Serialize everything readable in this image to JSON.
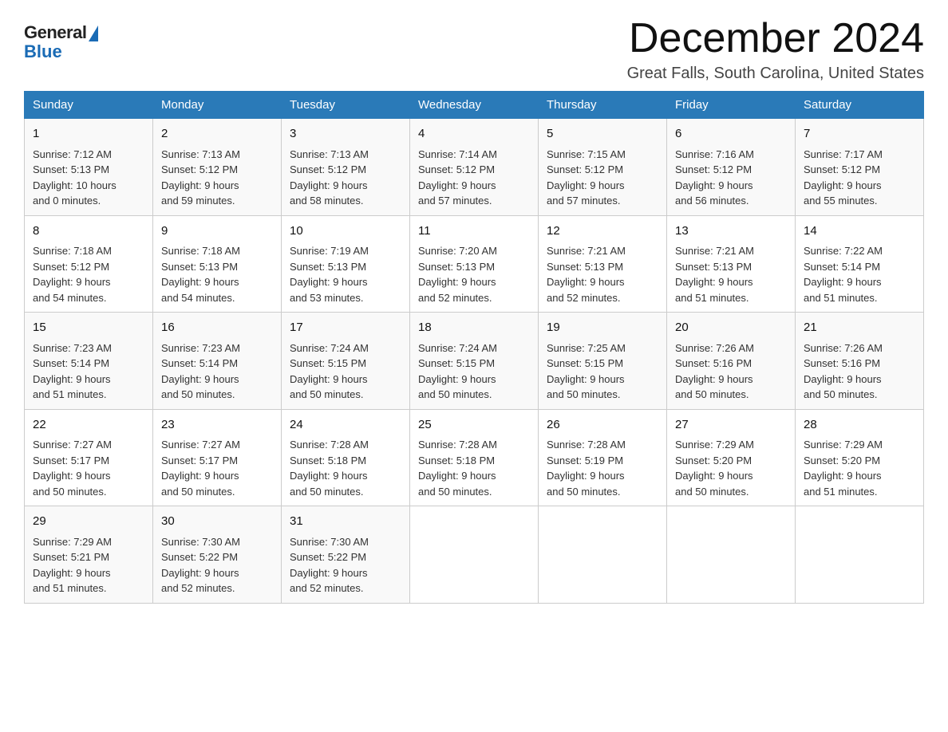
{
  "logo": {
    "general": "General",
    "blue": "Blue"
  },
  "header": {
    "month_year": "December 2024",
    "location": "Great Falls, South Carolina, United States"
  },
  "days_of_week": [
    "Sunday",
    "Monday",
    "Tuesday",
    "Wednesday",
    "Thursday",
    "Friday",
    "Saturday"
  ],
  "weeks": [
    [
      {
        "day": "1",
        "sunrise": "7:12 AM",
        "sunset": "5:13 PM",
        "daylight": "10 hours and 0 minutes."
      },
      {
        "day": "2",
        "sunrise": "7:13 AM",
        "sunset": "5:12 PM",
        "daylight": "9 hours and 59 minutes."
      },
      {
        "day": "3",
        "sunrise": "7:13 AM",
        "sunset": "5:12 PM",
        "daylight": "9 hours and 58 minutes."
      },
      {
        "day": "4",
        "sunrise": "7:14 AM",
        "sunset": "5:12 PM",
        "daylight": "9 hours and 57 minutes."
      },
      {
        "day": "5",
        "sunrise": "7:15 AM",
        "sunset": "5:12 PM",
        "daylight": "9 hours and 57 minutes."
      },
      {
        "day": "6",
        "sunrise": "7:16 AM",
        "sunset": "5:12 PM",
        "daylight": "9 hours and 56 minutes."
      },
      {
        "day": "7",
        "sunrise": "7:17 AM",
        "sunset": "5:12 PM",
        "daylight": "9 hours and 55 minutes."
      }
    ],
    [
      {
        "day": "8",
        "sunrise": "7:18 AM",
        "sunset": "5:12 PM",
        "daylight": "9 hours and 54 minutes."
      },
      {
        "day": "9",
        "sunrise": "7:18 AM",
        "sunset": "5:13 PM",
        "daylight": "9 hours and 54 minutes."
      },
      {
        "day": "10",
        "sunrise": "7:19 AM",
        "sunset": "5:13 PM",
        "daylight": "9 hours and 53 minutes."
      },
      {
        "day": "11",
        "sunrise": "7:20 AM",
        "sunset": "5:13 PM",
        "daylight": "9 hours and 52 minutes."
      },
      {
        "day": "12",
        "sunrise": "7:21 AM",
        "sunset": "5:13 PM",
        "daylight": "9 hours and 52 minutes."
      },
      {
        "day": "13",
        "sunrise": "7:21 AM",
        "sunset": "5:13 PM",
        "daylight": "9 hours and 51 minutes."
      },
      {
        "day": "14",
        "sunrise": "7:22 AM",
        "sunset": "5:14 PM",
        "daylight": "9 hours and 51 minutes."
      }
    ],
    [
      {
        "day": "15",
        "sunrise": "7:23 AM",
        "sunset": "5:14 PM",
        "daylight": "9 hours and 51 minutes."
      },
      {
        "day": "16",
        "sunrise": "7:23 AM",
        "sunset": "5:14 PM",
        "daylight": "9 hours and 50 minutes."
      },
      {
        "day": "17",
        "sunrise": "7:24 AM",
        "sunset": "5:15 PM",
        "daylight": "9 hours and 50 minutes."
      },
      {
        "day": "18",
        "sunrise": "7:24 AM",
        "sunset": "5:15 PM",
        "daylight": "9 hours and 50 minutes."
      },
      {
        "day": "19",
        "sunrise": "7:25 AM",
        "sunset": "5:15 PM",
        "daylight": "9 hours and 50 minutes."
      },
      {
        "day": "20",
        "sunrise": "7:26 AM",
        "sunset": "5:16 PM",
        "daylight": "9 hours and 50 minutes."
      },
      {
        "day": "21",
        "sunrise": "7:26 AM",
        "sunset": "5:16 PM",
        "daylight": "9 hours and 50 minutes."
      }
    ],
    [
      {
        "day": "22",
        "sunrise": "7:27 AM",
        "sunset": "5:17 PM",
        "daylight": "9 hours and 50 minutes."
      },
      {
        "day": "23",
        "sunrise": "7:27 AM",
        "sunset": "5:17 PM",
        "daylight": "9 hours and 50 minutes."
      },
      {
        "day": "24",
        "sunrise": "7:28 AM",
        "sunset": "5:18 PM",
        "daylight": "9 hours and 50 minutes."
      },
      {
        "day": "25",
        "sunrise": "7:28 AM",
        "sunset": "5:18 PM",
        "daylight": "9 hours and 50 minutes."
      },
      {
        "day": "26",
        "sunrise": "7:28 AM",
        "sunset": "5:19 PM",
        "daylight": "9 hours and 50 minutes."
      },
      {
        "day": "27",
        "sunrise": "7:29 AM",
        "sunset": "5:20 PM",
        "daylight": "9 hours and 50 minutes."
      },
      {
        "day": "28",
        "sunrise": "7:29 AM",
        "sunset": "5:20 PM",
        "daylight": "9 hours and 51 minutes."
      }
    ],
    [
      {
        "day": "29",
        "sunrise": "7:29 AM",
        "sunset": "5:21 PM",
        "daylight": "9 hours and 51 minutes."
      },
      {
        "day": "30",
        "sunrise": "7:30 AM",
        "sunset": "5:22 PM",
        "daylight": "9 hours and 52 minutes."
      },
      {
        "day": "31",
        "sunrise": "7:30 AM",
        "sunset": "5:22 PM",
        "daylight": "9 hours and 52 minutes."
      },
      null,
      null,
      null,
      null
    ]
  ],
  "labels": {
    "sunrise": "Sunrise:",
    "sunset": "Sunset:",
    "daylight": "Daylight:"
  }
}
